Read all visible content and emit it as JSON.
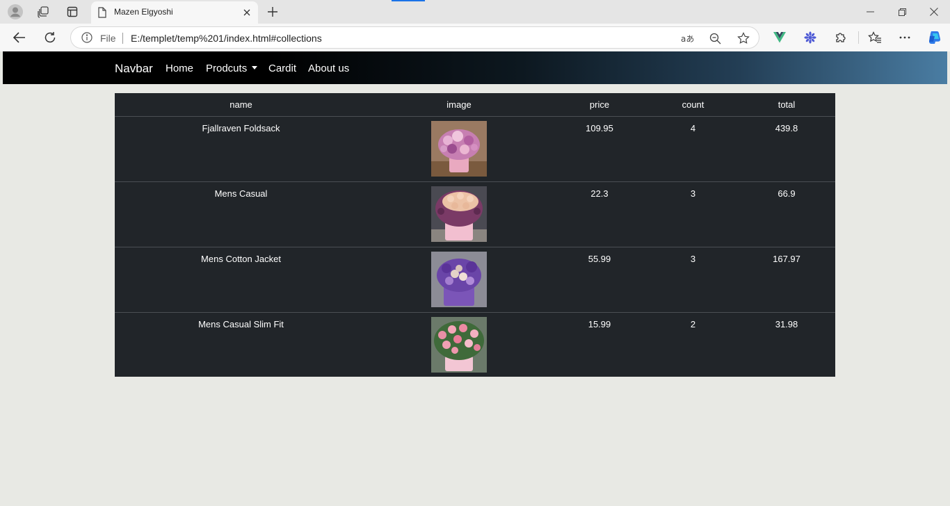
{
  "browser": {
    "tab_title": "Mazen Elgyoshi",
    "omnibox": {
      "site_info_label": "File",
      "url": "E:/templet/temp%201/index.html#collections"
    },
    "accent_color": "#1a73e8"
  },
  "navbar": {
    "brand": "Navbar",
    "links": [
      {
        "label": "Home"
      },
      {
        "label": "Prodcuts",
        "has_dropdown": true
      },
      {
        "label": "Cardit"
      },
      {
        "label": "About us"
      }
    ],
    "background_colors": [
      "#000000",
      "#4a7da3"
    ]
  },
  "cart_table": {
    "columns": [
      "name",
      "image",
      "price",
      "count",
      "total"
    ],
    "rows": [
      {
        "name": "Fjallraven Foldsack",
        "image": "flower-bouquet-pink-purple-box",
        "price": "109.95",
        "count": "4",
        "total": "439.8"
      },
      {
        "name": "Mens Casual",
        "image": "flower-bouquet-peach-roses-pink-box",
        "price": "22.3",
        "count": "3",
        "total": "66.9"
      },
      {
        "name": "Mens Cotton Jacket",
        "image": "flower-bouquet-purple-box",
        "price": "55.99",
        "count": "3",
        "total": "167.97"
      },
      {
        "name": "Mens Casual Slim Fit",
        "image": "flower-bouquet-pink-roses",
        "price": "15.99",
        "count": "2",
        "total": "31.98"
      }
    ],
    "table_color": "#212529"
  }
}
